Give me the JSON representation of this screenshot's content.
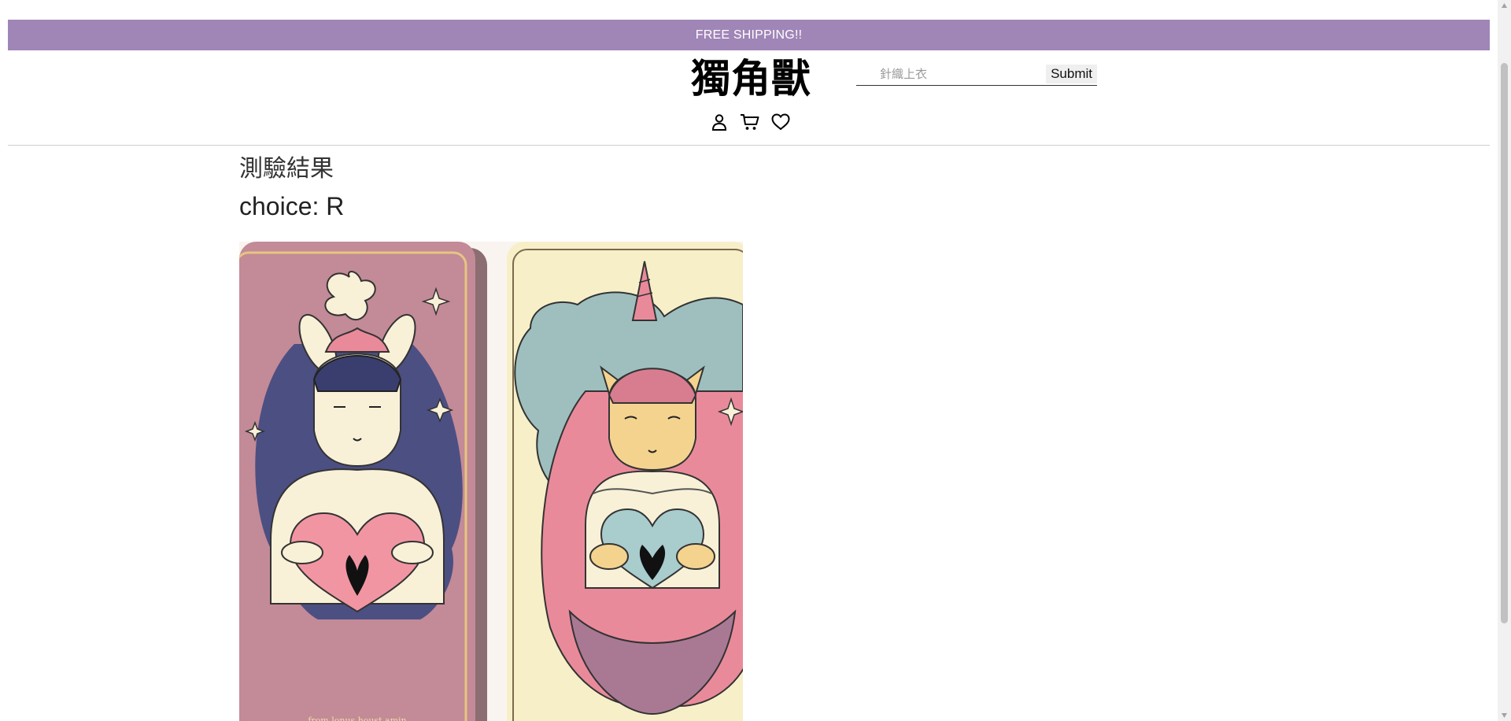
{
  "banner": {
    "text": "FREE SHIPPING!!"
  },
  "header": {
    "brand": "獨角獸",
    "search": {
      "placeholder": "針織上衣",
      "value": "",
      "submit_label": "Submit"
    },
    "icons": [
      "user-icon",
      "cart-icon",
      "heart-icon"
    ]
  },
  "main": {
    "title": "測驗結果",
    "choice": "choice: R"
  },
  "colors": {
    "banner_bg": "#a085b7",
    "banner_text": "#ffffff",
    "card_left_bg": "#c38a97",
    "card_right_bg": "#f7efc8",
    "teal": "#9ebfbe",
    "pink": "#e98a9b"
  }
}
